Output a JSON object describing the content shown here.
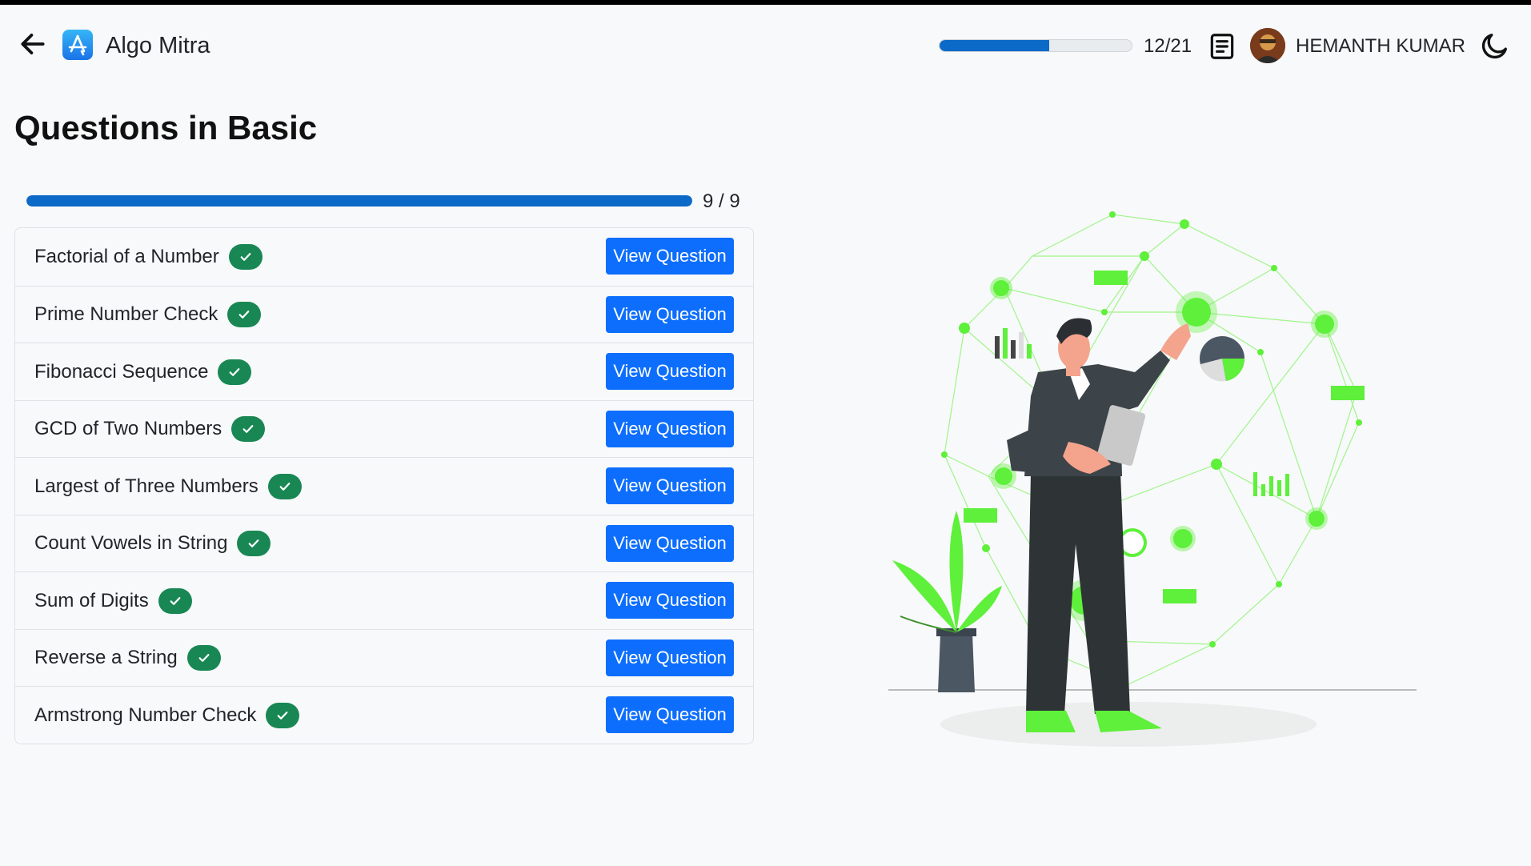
{
  "app": {
    "brand": "Algo Mitra",
    "progress_count": "12/21",
    "progress_fraction": 0.571,
    "user_name": "HEMANTH KUMAR"
  },
  "page": {
    "title": "Questions in Basic",
    "progress_count": "9 / 9",
    "progress_fraction": 1.0
  },
  "questions": [
    {
      "title": "Factorial of a Number",
      "status": "completed",
      "button": "View Question"
    },
    {
      "title": "Prime Number Check",
      "status": "completed",
      "button": "View Question"
    },
    {
      "title": "Fibonacci Sequence",
      "status": "completed",
      "button": "View Question"
    },
    {
      "title": "GCD of Two Numbers",
      "status": "completed",
      "button": "View Question"
    },
    {
      "title": "Largest of Three Numbers",
      "status": "completed",
      "button": "View Question"
    },
    {
      "title": "Count Vowels in String",
      "status": "completed",
      "button": "View Question"
    },
    {
      "title": "Sum of Digits",
      "status": "completed",
      "button": "View Question"
    },
    {
      "title": "Reverse a String",
      "status": "completed",
      "button": "View Question"
    },
    {
      "title": "Armstrong Number Check",
      "status": "completed",
      "button": "View Question"
    }
  ],
  "icons": {
    "back": "arrow-left-icon",
    "logo": "app-store-icon",
    "notes": "document-icon",
    "theme": "moon-icon",
    "check": "check-icon"
  },
  "colors": {
    "primary": "#0d6efd",
    "progress": "#0b69c7",
    "success": "#198754",
    "accent_green": "#5ef03a"
  }
}
